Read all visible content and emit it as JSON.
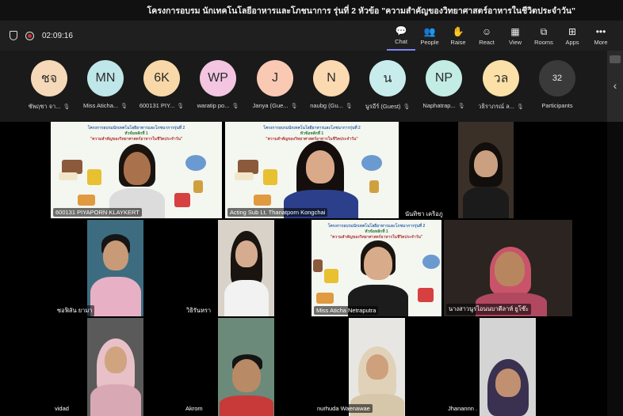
{
  "title": "โครงการอบรม นักเทคโนโลยีอาหารและโภชนาการ รุ่นที่ 2 หัวข้อ \"ความสำคัญของวิทยาศาสตร์อาหารในชีวิตประจำวัน\"",
  "toolbar": {
    "timer": "02:09:16",
    "buttons": [
      {
        "label": "Chat",
        "icon": "chat-icon",
        "glyph": "💬"
      },
      {
        "label": "People",
        "icon": "people-icon",
        "glyph": "👥"
      },
      {
        "label": "Raise",
        "icon": "raise-hand-icon",
        "glyph": "✋"
      },
      {
        "label": "React",
        "icon": "react-icon",
        "glyph": "☺"
      },
      {
        "label": "View",
        "icon": "view-grid-icon",
        "glyph": "▦"
      },
      {
        "label": "Rooms",
        "icon": "rooms-icon",
        "glyph": "⧉"
      },
      {
        "label": "Apps",
        "icon": "apps-icon",
        "glyph": "⊞"
      },
      {
        "label": "More",
        "icon": "more-icon",
        "glyph": "•••"
      }
    ]
  },
  "roster": [
    {
      "initials": "ชจ",
      "name": "ชัพฤชา จา...",
      "color": "#f5d9b8"
    },
    {
      "initials": "MN",
      "name": "Miss Aticha...",
      "color": "#bfe6e8"
    },
    {
      "initials": "6K",
      "name": "600131 PIY...",
      "color": "#f8d8a8"
    },
    {
      "initials": "WP",
      "name": "waratip po...",
      "color": "#f3c5e0"
    },
    {
      "initials": "J",
      "name": "Janya (Gue...",
      "color": "#f9c9b4"
    },
    {
      "initials": "N",
      "name": "naubg (Gu...",
      "color": "#fbd9b1"
    },
    {
      "initials": "น",
      "name": "นูรอีร์ (Guest)",
      "color": "#c8ecec"
    },
    {
      "initials": "NP",
      "name": "Naphatrap...",
      "color": "#c2ece4"
    },
    {
      "initials": "วล",
      "name": "วธิราภรณ์ ล...",
      "color": "#fbe1a8"
    },
    {
      "initials": "32",
      "name": "Participants",
      "color": "#3a3a3a"
    }
  ],
  "tiles": [
    {
      "name": "600131 PIYAPORN KLAYKERT"
    },
    {
      "name": "Acting Sub Lt. Thanatporn Kongchai"
    },
    {
      "name": "นันทิชา เคริอภู"
    },
    {
      "name": "ซอฟิลัน ยามา"
    },
    {
      "name": "วิธิรันหรา"
    },
    {
      "name": "Miss Aticha Netraputra"
    },
    {
      "name": "นางสาวนูรไอนนบาตีลาห์ ยูโซ๊ะ"
    },
    {
      "name": "vidad"
    },
    {
      "name": "Akrom"
    },
    {
      "name": "nurhuda Waenawae"
    },
    {
      "name": "Jhanannn ."
    }
  ],
  "slide": {
    "line1": "โครงการอบรมนักเทคโนโลยีอาหารและโภชนาการรุ่นที่ 2",
    "line2": "หัวข้อหลักที่ 1",
    "line3": "\"ความสำคัญของวิทยาศาสตร์อาหารในชีวิตประจำวัน\""
  }
}
